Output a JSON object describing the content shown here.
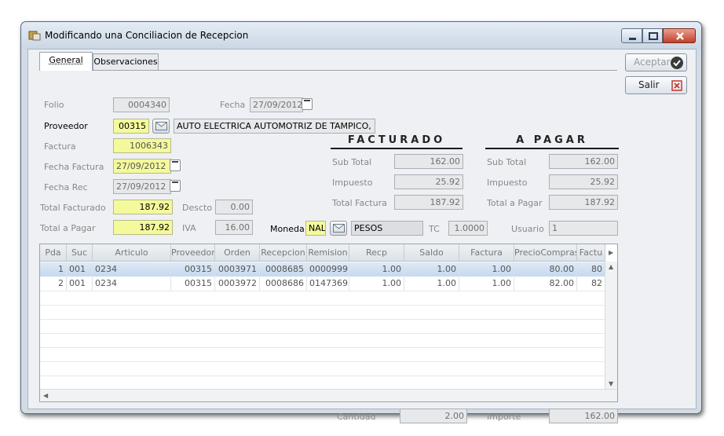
{
  "window": {
    "title": "Modificando una Conciliacion de Recepcion"
  },
  "tabs": [
    {
      "label": "General"
    },
    {
      "label": "Observaciones"
    }
  ],
  "buttons": {
    "accept": "Aceptar",
    "exit": "Salir"
  },
  "form": {
    "folio": {
      "label": "Folio",
      "value": "0004340"
    },
    "fecha": {
      "label": "Fecha",
      "value": "27/09/2012"
    },
    "proveedor": {
      "label": "Proveedor",
      "code": "00315",
      "name": "AUTO ELECTRICA AUTOMOTRIZ DE TAMPICO, S.A DE"
    },
    "factura": {
      "label": "Factura",
      "value": "1006343"
    },
    "fecha_factura": {
      "label": "Fecha Factura",
      "value": "27/09/2012"
    },
    "fecha_rec": {
      "label": "Fecha Rec",
      "value": "27/09/2012"
    },
    "total_facturado": {
      "label": "Total Facturado",
      "value": "187.92"
    },
    "descto": {
      "label": "Descto",
      "value": "0.00"
    },
    "total_pagar": {
      "label": "Total a Pagar",
      "value": "187.92"
    },
    "iva": {
      "label": "IVA",
      "value": "16.00"
    },
    "moneda": {
      "label": "Moneda",
      "code": "NAL",
      "name": "PESOS"
    },
    "tc": {
      "label": "TC",
      "value": "1.0000"
    },
    "usuario": {
      "label": "Usuario",
      "value": "1"
    }
  },
  "facturado": {
    "heading": "FACTURADO",
    "sub_total": {
      "label": "Sub Total",
      "value": "162.00"
    },
    "impuesto": {
      "label": "Impuesto",
      "value": "25.92"
    },
    "total_factura": {
      "label": "Total Factura",
      "value": "187.92"
    }
  },
  "apagar": {
    "heading": "A PAGAR",
    "sub_total": {
      "label": "Sub Total",
      "value": "162.00"
    },
    "impuesto": {
      "label": "Impuesto",
      "value": "25.92"
    },
    "total_pagar": {
      "label": "Total a Pagar",
      "value": "187.92"
    }
  },
  "grid": {
    "columns": [
      "Pda",
      "Suc",
      "Articulo",
      "Proveedor",
      "Orden",
      "Recepcion",
      "Remision",
      "Recp",
      "Saldo",
      "Factura",
      "PrecioCompras",
      "Factu"
    ],
    "rows": [
      [
        "1",
        "001",
        "0234",
        "00315",
        "0003971",
        "0008685",
        "0000999",
        "1.00",
        "1.00",
        "1.00",
        "80.00",
        "80"
      ],
      [
        "2",
        "001",
        "0234",
        "00315",
        "0003972",
        "0008686",
        "0147369",
        "1.00",
        "1.00",
        "1.00",
        "82.00",
        "82"
      ]
    ]
  },
  "footer": {
    "cantidad": {
      "label": "Cantidad",
      "value": "2.00"
    },
    "importe": {
      "label": "Importe",
      "value": "162.00"
    }
  }
}
